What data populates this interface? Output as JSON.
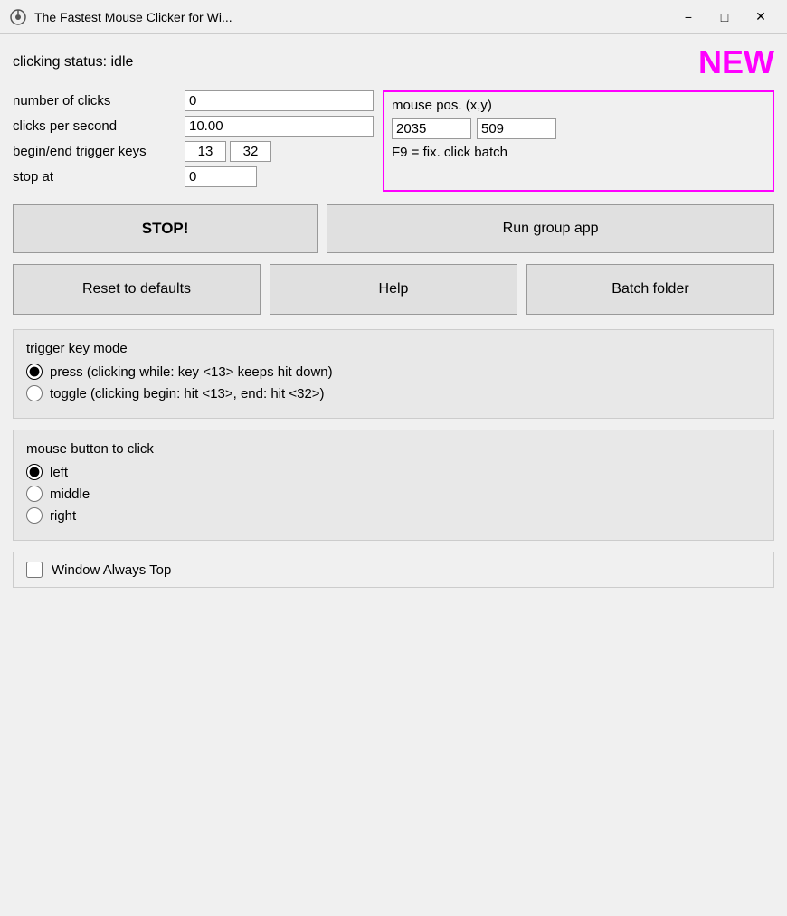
{
  "titleBar": {
    "title": "The Fastest Mouse Clicker for Wi...",
    "minimizeLabel": "−",
    "maximizeLabel": "□",
    "closeLabel": "✕"
  },
  "status": {
    "label": "clicking status: idle",
    "newBadge": "NEW"
  },
  "fields": {
    "numberOfClicksLabel": "number of clicks",
    "numberOfClicksValue": "0",
    "clicksPerSecondLabel": "clicks per second",
    "clicksPerSecondValue": "10.00",
    "triggerKeysLabel": "begin/end trigger keys",
    "triggerKey1": "13",
    "triggerKey2": "32",
    "stopAtLabel": "stop at",
    "stopAtValue": "0"
  },
  "mousePos": {
    "label": "mouse pos. (x,y)",
    "xValue": "2035",
    "yValue": "509",
    "f9Text": "F9 = fix. click batch"
  },
  "buttons": {
    "stopLabel": "STOP!",
    "runGroupLabel": "Run group app",
    "resetLabel": "Reset to defaults",
    "helpLabel": "Help",
    "batchFolderLabel": "Batch folder"
  },
  "triggerKeyMode": {
    "sectionTitle": "trigger key mode",
    "pressLabel": "press (clicking while: key <13> keeps hit down)",
    "toggleLabel": "toggle (clicking begin: hit <13>, end: hit <32>)"
  },
  "mouseButtonSection": {
    "sectionTitle": "mouse button to click",
    "leftLabel": "left",
    "middleLabel": "middle",
    "rightLabel": "right"
  },
  "windowAlwaysTop": {
    "label": "Window Always Top"
  }
}
